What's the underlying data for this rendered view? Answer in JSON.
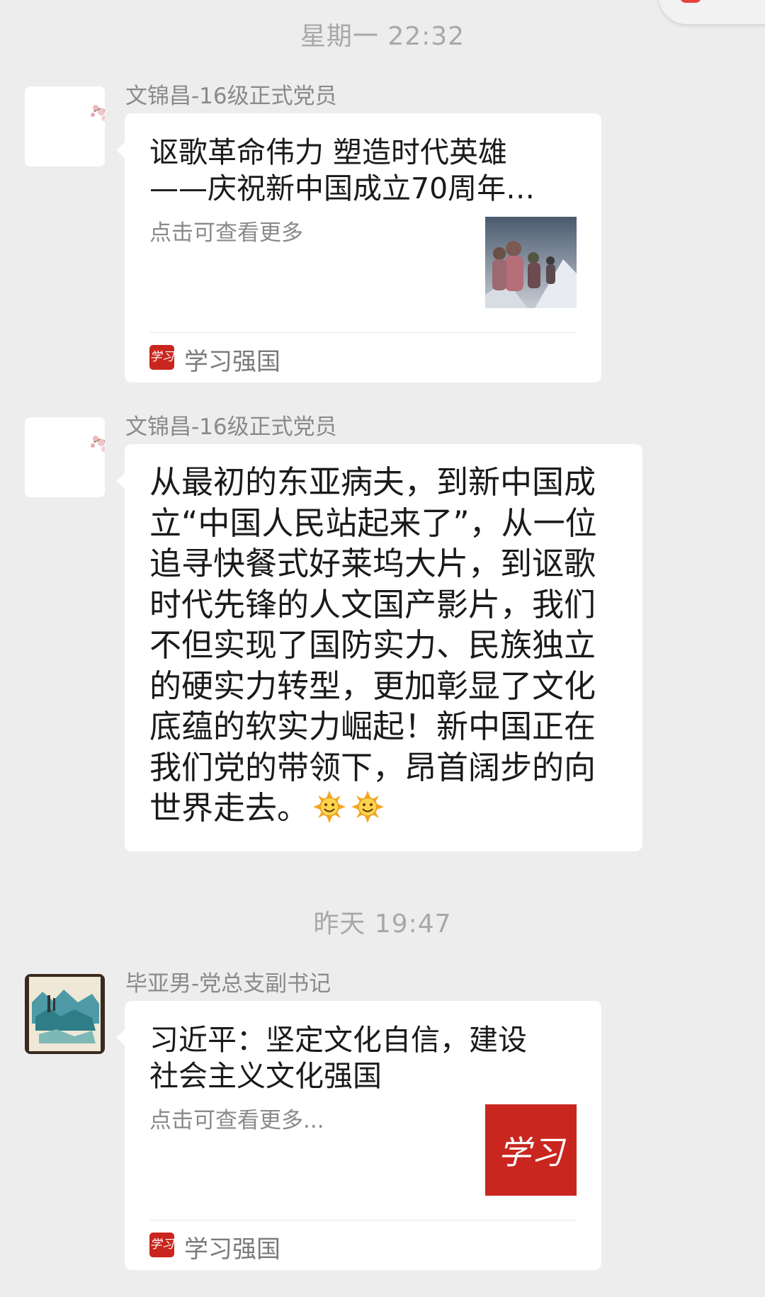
{
  "messages_area": {
    "timestamp_1": "星期一 22:32",
    "message_1": {
      "sender": "文锦昌-16级正式党员",
      "card_title": "讴歌革命伟力 塑造时代英雄\n——庆祝新中国成立70周年…",
      "card_desc": "点击可查看更多",
      "source_label": "学习强国",
      "source_icon_text": "学习"
    },
    "message_2": {
      "sender": "文锦昌-16级正式党员",
      "text": "从最初的东亚病夫，到新中国成\n立“中国人民站起来了”，从一位\n追寻快餐式好莱坞大片，到讴歌\n时代先锋的人文国产影片，我们\n不但实现了国防实力、民族独立\n的硬实力转型，更加彰显了文化\n底蕴的软实力崛起！新中国正在\n我们党的带领下，昂首阔步的向\n世界走去。",
      "emoji": [
        "sun-icon",
        "sun-icon"
      ]
    },
    "timestamp_2": "昨天 19:47",
    "message_3": {
      "sender": "毕亚男-党总支副书记",
      "card_title": "习近平：坚定文化自信，建设\n社会主义文化强国",
      "card_desc": "点击可查看更多...",
      "thumb_text": "学习",
      "source_label": "学习强国",
      "source_icon_text": "学习"
    }
  },
  "colors": {
    "background": "#ededed",
    "bubble": "#ffffff",
    "brand_red": "#c9261f",
    "timestamp_text": "#a8a8a8",
    "sender_text": "#8a8a8a"
  }
}
